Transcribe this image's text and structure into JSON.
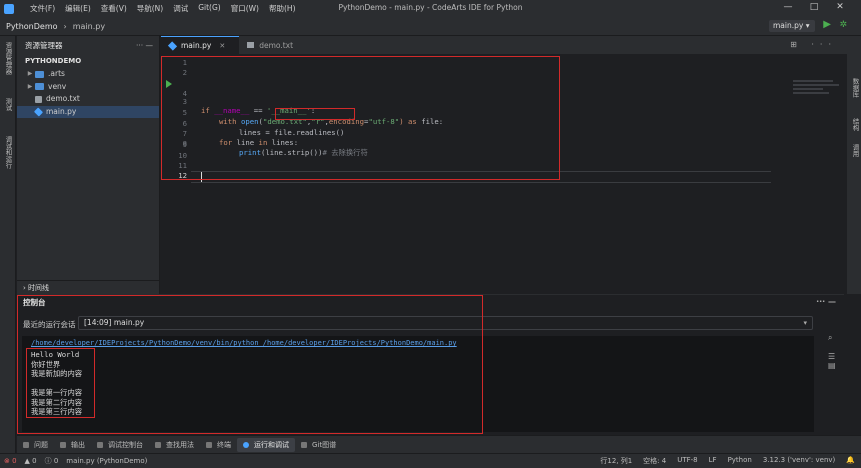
{
  "window": {
    "title": "PythonDemo - main.py - CodeArts IDE for Python",
    "menus": [
      "文件(F)",
      "编辑(E)",
      "查看(V)",
      "导航(N)",
      "调试",
      "Git(G)",
      "窗口(W)",
      "帮助(H)"
    ],
    "controls": [
      "—",
      "□",
      "✕"
    ]
  },
  "toolbar": {
    "project": "PythonDemo",
    "separator": "›",
    "file": "main.py",
    "run_config": "main.py ▾",
    "run_icon": "▶",
    "debug_icon": "✲"
  },
  "activity_bar": [
    "资源管理器",
    "测试",
    "调试和运行"
  ],
  "right_bar": [
    "数据库",
    "结构",
    "调用"
  ],
  "explorer": {
    "title": "资源管理器",
    "actions": "···  —",
    "root": "PYTHONDEMO",
    "items": [
      {
        "label": ".arts",
        "chevron": "▶"
      },
      {
        "label": "venv",
        "chevron": "▶"
      },
      {
        "label": "demo.txt",
        "chevron": ""
      },
      {
        "label": "main.py",
        "chevron": ""
      }
    ],
    "timeline": "› 时间线"
  },
  "editor": {
    "tabs": [
      {
        "label": "main.py",
        "close": "✕"
      },
      {
        "label": "demo.txt",
        "close": ""
      }
    ],
    "tab_actions": "⊞ ···",
    "line_numbers": [
      "1",
      "2",
      "3",
      "4",
      "5",
      "6",
      "7",
      "8",
      "9",
      "10",
      "11",
      "12"
    ],
    "code": {
      "l3_if": "if ",
      "l3_name": "__name__",
      "l3_eq": " == ",
      "l3_main": "'__main__'",
      "l3_colon": ":",
      "l5_with": "with ",
      "l5_open": "open",
      "l5_p1": "(",
      "l5_s1": "\"demo.txt\"",
      "l5_comma1": ",",
      "l5_s2": "\"r\"",
      "l5_comma2": ",",
      "l5_enc": "encoding",
      "l5_eq": "=",
      "l5_s3": "\"utf-8\"",
      "l5_as": ") as ",
      "l5_file": "file",
      "l5_colon": ":",
      "l6_lines": "lines = ",
      "l6_call": "file.readlines()",
      "l7_for": "for ",
      "l7_line": "line ",
      "l7_in": "in ",
      "l7_lines": "lines:",
      "l8_print": "print",
      "l8_args": "(line.strip())",
      "l8_comment": "# 去除换行符"
    }
  },
  "console": {
    "title": "控制台",
    "actions": "···  —",
    "session_label": "最近的运行会话",
    "session_value": "[14:09] main.py",
    "session_dropdown": "▾",
    "command": "/home/developer/IDEProjects/PythonDemo/venv/bin/python /home/developer/IDEProjects/PythonDemo/main.py",
    "output": [
      "Hello World",
      "你好世界",
      "我是新加的内容",
      "",
      "我是第一行内容",
      "我是第二行内容",
      "我是第三行内容"
    ]
  },
  "tool_tabs": [
    "问题",
    "输出",
    "调试控制台",
    "查找用法",
    "终端",
    "运行和调试",
    "Git图谱"
  ],
  "status": {
    "errors": "⊗ 0",
    "warnings": "▲ 0",
    "info": "ⓘ 0",
    "file": "main.py (PythonDemo)",
    "position": "行12, 列1",
    "spaces": "空格: 4",
    "encoding": "UTF-8",
    "eol": "LF",
    "language": "Python",
    "interpreter": "3.12.3 ('venv': venv)",
    "bell": "🔔"
  },
  "colors": {
    "accent": "#4aa3ff",
    "highlight_box": "#d22a2a",
    "run_green": "#4caf50"
  }
}
